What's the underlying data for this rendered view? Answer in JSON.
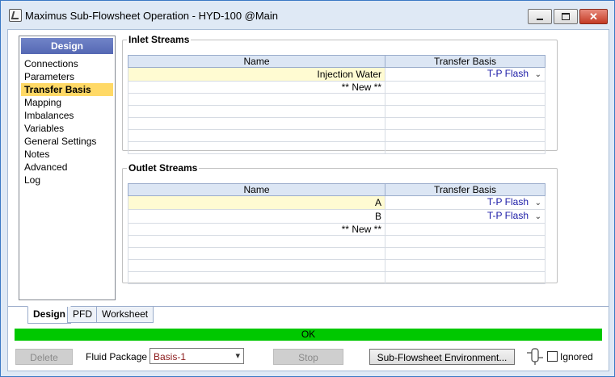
{
  "window": {
    "title": "Maximus Sub-Flowsheet Operation - HYD-100 @Main",
    "close_glyph": "✕"
  },
  "nav": {
    "header": "Design",
    "items": [
      "Connections",
      "Parameters",
      "Transfer Basis",
      "Mapping",
      "Imbalances",
      "Variables",
      "General Settings",
      "Notes",
      "Advanced",
      "Log"
    ],
    "active": "Transfer Basis"
  },
  "inlet": {
    "legend": "Inlet Streams",
    "col_name": "Name",
    "col_basis": "Transfer Basis",
    "rows": [
      {
        "name": "Injection Water",
        "basis": "T-P Flash"
      },
      {
        "name": "** New **",
        "basis": ""
      }
    ]
  },
  "outlet": {
    "legend": "Outlet Streams",
    "col_name": "Name",
    "col_basis": "Transfer Basis",
    "rows": [
      {
        "name": "A",
        "basis": "T-P Flash"
      },
      {
        "name": "B",
        "basis": "T-P Flash"
      },
      {
        "name": "** New **",
        "basis": ""
      }
    ]
  },
  "tabs": [
    "Design",
    "PFD",
    "Worksheet"
  ],
  "active_tab": "Design",
  "status": {
    "text": "OK",
    "color": "#00c800"
  },
  "bottom": {
    "delete_label": "Delete",
    "fluid_package_label": "Fluid Package",
    "fluid_package_value": "Basis-1",
    "stop_label": "Stop",
    "env_label": "Sub-Flowsheet Environment...",
    "ignored_label": "Ignored"
  },
  "icons": {
    "app": "app-icon",
    "dropdown": "chevron-down-icon",
    "flowsheet": "flowsheet-icon"
  }
}
